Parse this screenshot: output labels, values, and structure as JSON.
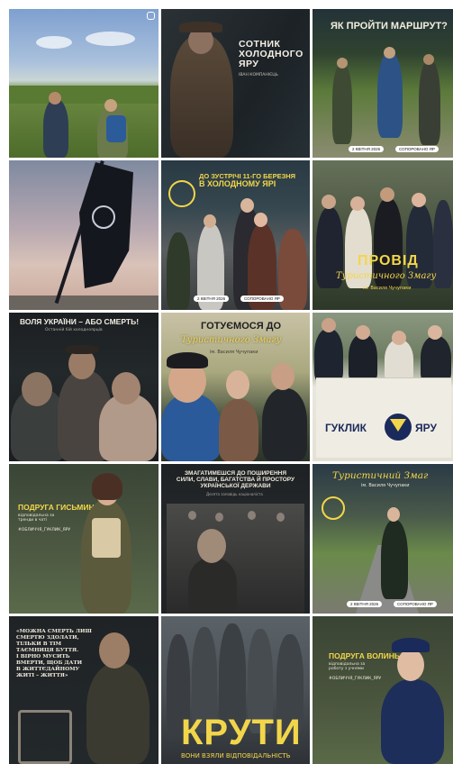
{
  "grid": {
    "columns": 3,
    "tiles": [
      {
        "id": "hikers-field",
        "type": "photo",
        "texts": [],
        "has_reel_icon": true
      },
      {
        "id": "sotnyk",
        "texts": [
          "СОТНИК",
          "ХОЛОДНОГО",
          "ЯРУ",
          "ІВАН КОМПАНІЄЦЬ"
        ]
      },
      {
        "id": "marsh",
        "texts": [
          "ЯК ПРОЙТИ МАРШРУТ?",
          "2 КВІТНЯ 2026",
          "СОПОРОВАНО ЯР"
        ]
      },
      {
        "id": "flag",
        "type": "photo",
        "texts": []
      },
      {
        "id": "zustrich",
        "texts": [
          "ДО ЗУСТРІЧІ 11-ГО БЕРЕЗНЯ",
          "В ХОЛОДНОМУ ЯРІ",
          "2 КВІТНЯ 2026",
          "СОПОРОВАНО ЯР"
        ]
      },
      {
        "id": "provid",
        "texts": [
          "ПРОВІД",
          "Туристичного Змагу",
          "ім. Василя Чучупаки"
        ]
      },
      {
        "id": "volya",
        "texts": [
          "ВОЛЯ УКРАЇНИ – АБО СМЕРТЬ!",
          "Останній бій холодноярців"
        ]
      },
      {
        "id": "gotuyemos",
        "texts": [
          "ГОТУЄМОСЯ ДО",
          "Туристичного Змагу",
          "ім. Василя Чучупаки"
        ]
      },
      {
        "id": "banner",
        "texts": [
          "ГУКЛИК",
          "ЯРУ"
        ]
      },
      {
        "id": "podruha-hysmyn",
        "texts": [
          "ПОДРУГА ГИСЬМИН",
          "відповідальна за",
          "тренди в чаті",
          "#ОБЛИЧЧЯ_ГУКЛИК_ЯРУ"
        ]
      },
      {
        "id": "zmahatymeshsia",
        "texts": [
          "ЗМАГАТИМЕШСЯ ДО ПОШИРЕННЯ",
          "СИЛИ, СЛАВИ, БАГАТСТВА Й ПРОСТОРУ",
          "УКРАЇНСЬКОЇ ДЕРЖАВИ",
          "Десята заповідь націоналіста"
        ]
      },
      {
        "id": "turystychnyi",
        "texts": [
          "Туристичний Змаг",
          "ім. Василя Чучупаки",
          "2 КВІТНЯ 2026",
          "СОПОРОВАНО ЯР"
        ]
      },
      {
        "id": "smert",
        "texts": [
          "«МОЖНА СМЕРТЬ ЛИШ",
          "СМЕРТЮ ЗДОЛАТИ,",
          "ТІЛЬКИ В ТІМ",
          "ТАЄМНИЦЯ БУТТЯ.",
          "І ВІРНО МУСИТЬ",
          "ВМЕРТИ, ЩОБ ДАТИ",
          "В ЖИТТЄДАЙНОМУ",
          "ЖИТІ – ЖИТТЯ»"
        ]
      },
      {
        "id": "kruty",
        "texts": [
          "КРУТИ",
          "ВОНИ ВЗЯЛИ ВІДПОВІДАЛЬНІСТЬ"
        ]
      },
      {
        "id": "podruha-volyn",
        "texts": [
          "ПОДРУГА ВОЛИНЬ",
          "відповідальна за",
          "роботу з учнями",
          "#ОБЛИЧЧЯ_ГУКЛИК_ЯРУ"
        ]
      }
    ]
  },
  "colors": {
    "accent_yellow": "#f2d64a",
    "dark": "#1c1f22",
    "olive": "#2f3a2b"
  }
}
